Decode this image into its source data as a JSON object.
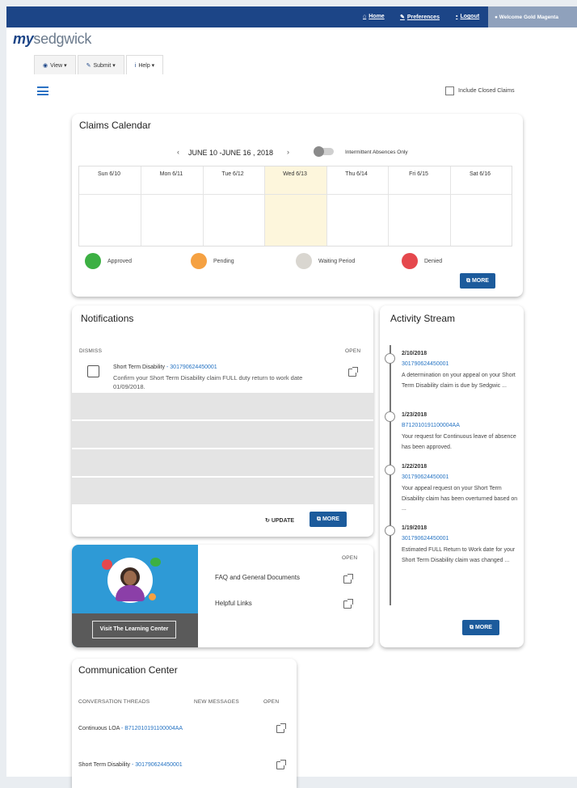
{
  "topbar": {
    "home": "Home",
    "preferences": "Preferences",
    "logout": "Logout",
    "welcome": "Welcome Gold Magenta"
  },
  "logo": {
    "prefix": "my",
    "suffix": "sedgwick"
  },
  "menu": {
    "view": "View",
    "submit": "Submit",
    "help": "Help"
  },
  "filters": {
    "include_closed": "Include Closed Claims"
  },
  "calendar": {
    "title": "Claims Calendar",
    "range": "JUNE 10 -JUNE 16 , 2018",
    "toggle_label": "Intermittent Absences Only",
    "days": [
      "Sun 6/10",
      "Mon 6/11",
      "Tue 6/12",
      "Wed 6/13",
      "Thu 6/14",
      "Fri 6/15",
      "Sat 6/16"
    ],
    "legend": [
      "Approved",
      "Pending",
      "Waiting Period",
      "Denied"
    ],
    "legend_colors": [
      "#3cb043",
      "#f5a142",
      "#d9d6d0",
      "#e5484d"
    ],
    "more": "MORE"
  },
  "notifications": {
    "title": "Notifications",
    "col_dismiss": "DISMISS",
    "col_open": "OPEN",
    "item": {
      "type": "Short Term Disability",
      "claim": "- 301790624450001",
      "message": "Confirm your Short Term Disability claim FULL duty return to work date 01/09/2018."
    },
    "update": "UPDATE",
    "more": "MORE"
  },
  "activity": {
    "title": "Activity Stream",
    "items": [
      {
        "date": "2/10/2018",
        "claim": "301790624450001",
        "text": "A determination on your appeal on your Short Term Disability claim is due by Sedgwic ..."
      },
      {
        "date": "1/23/2018",
        "claim": "B712010191100004AA",
        "text": "Your request for Continuous leave of absence has been approved."
      },
      {
        "date": "1/22/2018",
        "claim": "301790624450001",
        "text": "Your appeal request on your Short Term Disability claim has been overturned based on ..."
      },
      {
        "date": "1/19/2018",
        "claim": "301790624450001",
        "text": "Estimated FULL Return to Work date for your Short Term Disability claim was changed ..."
      }
    ],
    "more": "MORE"
  },
  "learning": {
    "button": "Visit The Learning Center",
    "col_open": "OPEN",
    "links": [
      "FAQ and General Documents",
      "Helpful Links"
    ]
  },
  "communication": {
    "title": "Communication Center",
    "col_threads": "CONVERSATION THREADS",
    "col_new": "NEW MESSAGES",
    "col_open": "OPEN",
    "threads": [
      {
        "label": "Continuous LOA",
        "claim": "- B712010191100004AA"
      },
      {
        "label": "Short Term Disability",
        "claim": "- 301790624450001"
      }
    ]
  }
}
